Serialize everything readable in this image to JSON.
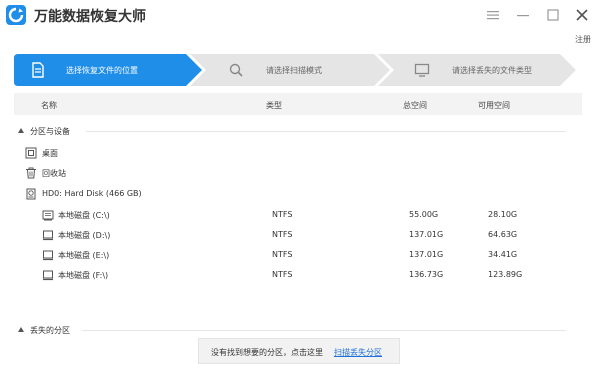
{
  "app": {
    "title": "万能数据恢复大师",
    "register": "注册"
  },
  "colors": {
    "accent": "#1f8ee8",
    "step_inactive": "#e5e5e5",
    "link": "#1e6fd9"
  },
  "steps": [
    {
      "label": "选择恢复文件的位置",
      "icon": "file-icon",
      "active": true
    },
    {
      "label": "请选择扫描模式",
      "icon": "search-icon",
      "active": false
    },
    {
      "label": "请选择丢失的文件类型",
      "icon": "monitor-icon",
      "active": false
    }
  ],
  "columns": {
    "name": "名称",
    "type": "类型",
    "total": "总空间",
    "free": "可用空间"
  },
  "sections": {
    "partitions": "分区与设备",
    "lost": "丢失的分区"
  },
  "locations": [
    {
      "name": "桌面",
      "icon": "desktop-icon"
    },
    {
      "name": "回收站",
      "icon": "recycle-bin-icon"
    }
  ],
  "disk": {
    "name": "HD0: Hard Disk (466 GB)",
    "icon": "hard-disk-icon"
  },
  "drives": [
    {
      "name": "本地磁盘 (C:\\)",
      "type": "NTFS",
      "total": "55.00G",
      "free": "28.10G",
      "icon": "system-drive-icon"
    },
    {
      "name": "本地磁盘 (D:\\)",
      "type": "NTFS",
      "total": "137.01G",
      "free": "64.63G",
      "icon": "drive-icon"
    },
    {
      "name": "本地磁盘 (E:\\)",
      "type": "NTFS",
      "total": "137.01G",
      "free": "34.41G",
      "icon": "drive-icon"
    },
    {
      "name": "本地磁盘 (F:\\)",
      "type": "NTFS",
      "total": "136.73G",
      "free": "123.89G",
      "icon": "drive-icon"
    }
  ],
  "bottom": {
    "message": "没有找到想要的分区，点击这里",
    "link": "扫描丢失分区"
  }
}
